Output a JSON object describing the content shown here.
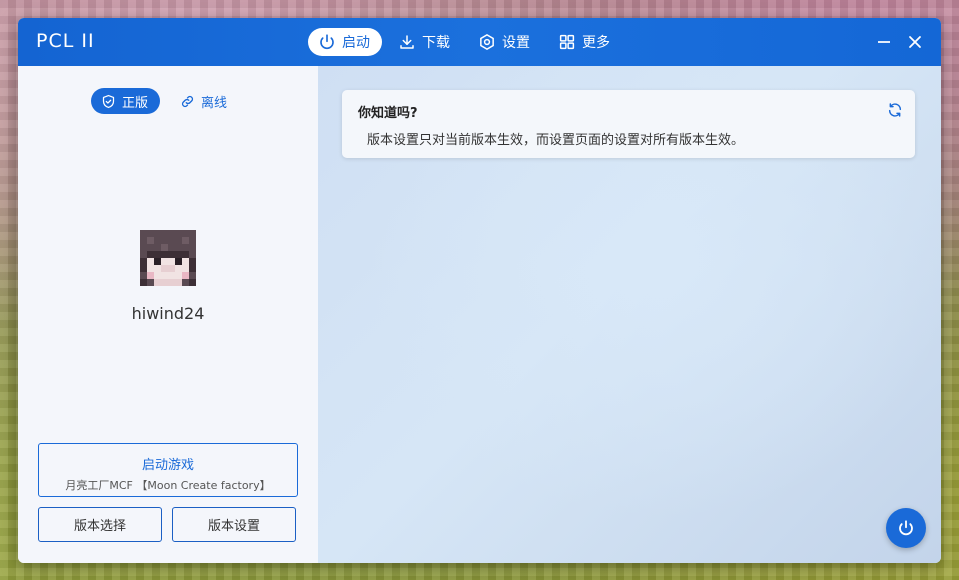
{
  "app": {
    "title": "PCL II"
  },
  "nav": {
    "items": [
      {
        "label": "启动",
        "icon": "power-icon",
        "active": true
      },
      {
        "label": "下载",
        "icon": "download-icon",
        "active": false
      },
      {
        "label": "设置",
        "icon": "settings-icon",
        "active": false
      },
      {
        "label": "更多",
        "icon": "grid-icon",
        "active": false
      }
    ]
  },
  "window_controls": {
    "minimize": "minimize-icon",
    "close": "close-icon"
  },
  "account": {
    "modes": [
      {
        "label": "正版",
        "icon": "shield-icon",
        "active": true
      },
      {
        "label": "离线",
        "icon": "link-icon",
        "active": false
      }
    ],
    "username": "hiwind24"
  },
  "launch": {
    "title": "启动游戏",
    "subtitle": "月亮工厂MCF 【Moon Create factory】",
    "version_select": "版本选择",
    "version_settings": "版本设置"
  },
  "tip": {
    "title": "你知道吗?",
    "text": "版本设置只对当前版本生效，而设置页面的设置对所有版本生效。"
  },
  "colors": {
    "accent": "#1a6ad8",
    "titlebar": "#1467d6",
    "panel": "#f4f6fb"
  }
}
